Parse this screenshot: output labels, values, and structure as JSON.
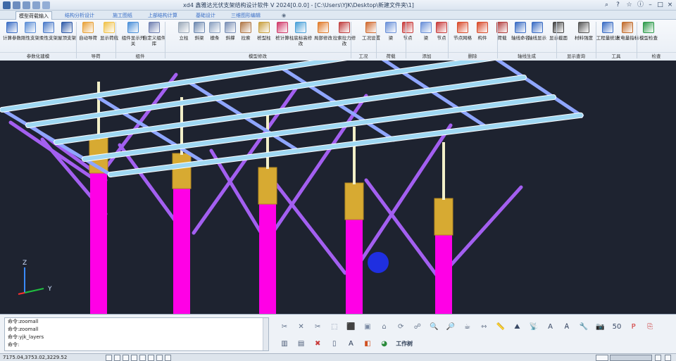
{
  "window": {
    "title": "xd4 鑫雅达光伏支架结构设计软件 V 2024[0.0.0] - [C:\\Users\\YJK\\Desktop\\新建文件夹\\1]"
  },
  "tabs": [
    {
      "label": "模型荷载输入",
      "active": true
    },
    {
      "label": "结构分析设计",
      "active": false
    },
    {
      "label": "施工图纸",
      "active": false
    },
    {
      "label": "上部结构计算",
      "active": false
    },
    {
      "label": "基础设计",
      "active": false
    },
    {
      "label": "三维图形编辑",
      "active": false
    }
  ],
  "ribbon": {
    "buttons": [
      {
        "label": "计算参数",
        "icon": "calc-params-icon"
      },
      {
        "label": "刚性支架",
        "icon": "rigid-support-icon"
      },
      {
        "label": "柔性支架",
        "icon": "flexible-support-icon"
      },
      {
        "label": "屋顶支架",
        "icon": "roof-support-icon"
      },
      {
        "label": "自动导荷",
        "icon": "auto-load-icon"
      },
      {
        "label": "显示荷载",
        "icon": "show-load-icon"
      },
      {
        "label": "组件显示开关",
        "icon": "component-toggle-icon"
      },
      {
        "label": "自定义组件库",
        "icon": "component-library-icon"
      },
      {
        "label": "立柱",
        "icon": "column-icon"
      },
      {
        "label": "斜梁",
        "icon": "inclined-beam-icon"
      },
      {
        "label": "檩条",
        "icon": "purlin-icon"
      },
      {
        "label": "斜撑",
        "icon": "brace-icon"
      },
      {
        "label": "拉索",
        "icon": "cable-icon"
      },
      {
        "label": "桩型柱",
        "icon": "pile-column-icon"
      },
      {
        "label": "桩计算",
        "icon": "pile-calc-icon"
      },
      {
        "label": "柱底标高修改",
        "icon": "column-base-icon"
      },
      {
        "label": "局部修改",
        "icon": "local-edit-icon"
      },
      {
        "label": "拉索拉力修改",
        "icon": "cable-force-icon"
      },
      {
        "label": "工况设置",
        "icon": "load-case-icon"
      },
      {
        "label": "梁",
        "icon": "beam-icon"
      },
      {
        "label": "节点",
        "icon": "node-icon"
      },
      {
        "label": "梁",
        "icon": "beam-add-icon"
      },
      {
        "label": "节点",
        "icon": "node-add-icon"
      },
      {
        "label": "节点网格",
        "icon": "node-grid-icon"
      },
      {
        "label": "构件",
        "icon": "member-icon"
      },
      {
        "label": "荷载",
        "icon": "load-delete-icon"
      },
      {
        "label": "轴线命名",
        "icon": "axis-name-icon"
      },
      {
        "label": "轴线显示",
        "icon": "axis-show-icon"
      },
      {
        "label": "显示截面",
        "icon": "show-section-icon"
      },
      {
        "label": "材料强度",
        "icon": "material-icon"
      },
      {
        "label": "工程量统计",
        "icon": "quantity-icon"
      },
      {
        "label": "发电量指标",
        "icon": "power-icon"
      },
      {
        "label": "模型检查",
        "icon": "model-check-icon"
      }
    ],
    "groups": [
      {
        "label": "参数化建模"
      },
      {
        "label": "导荷"
      },
      {
        "label": "组件"
      },
      {
        "label": "模型修改"
      },
      {
        "label": "工况"
      },
      {
        "label": "荷载"
      },
      {
        "label": "添加"
      },
      {
        "label": "删除"
      },
      {
        "label": "轴线生成"
      },
      {
        "label": "显示查询"
      },
      {
        "label": "工具"
      },
      {
        "label": "检查"
      }
    ]
  },
  "viewport": {
    "background": "#1e2330",
    "colors": {
      "purlin": "#9fd8f3",
      "rafter": "#8fa6ff",
      "brace": "#a35ff0",
      "column": "#ff00e6",
      "column_cap": "#d7aa32",
      "post": "#f2efc8",
      "marker": "#1f2fe0"
    },
    "axes": {
      "z": "Z",
      "y": "Y",
      "x": "X"
    }
  },
  "command": {
    "history": [
      "命令:zoomall",
      "命令:zoomall",
      "命令:yjk_layers"
    ],
    "prompt": "命令:"
  },
  "toolbar": {
    "icons": [
      "measure-icon",
      "intersect-icon",
      "trim-icon",
      "box-view-icon",
      "cube-view-icon",
      "front-view-icon",
      "home-view-icon",
      "rotate-view-icon",
      "orbit-icon",
      "zoom-in-icon",
      "zoom-window-icon",
      "teapot-icon",
      "measure-line-icon",
      "ruler-icon",
      "mountain-icon",
      "antenna-icon",
      "text-a-icon",
      "text-style-icon",
      "wrench-icon",
      "camera-icon",
      "number-50-icon",
      "pdf-icon",
      "export-icon",
      "barcode-icon",
      "layers-icon",
      "delete-icon",
      "page-icon",
      "text-box-icon",
      "color-palette-icon",
      "color-wheel-icon"
    ],
    "work_tree_label": "工作树"
  },
  "status": {
    "coords": "7175.04,3753.02,3229.52"
  }
}
